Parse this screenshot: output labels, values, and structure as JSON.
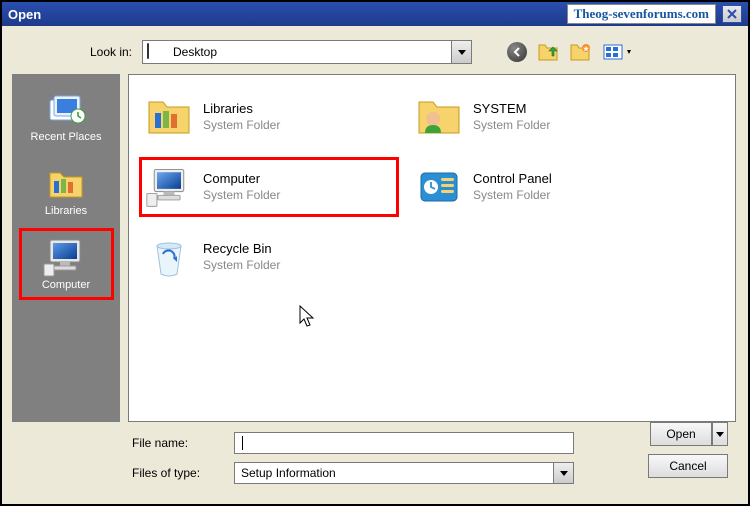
{
  "window": {
    "title": "Open",
    "watermark": "Theog-sevenforums.com"
  },
  "lookin": {
    "label": "Look in:",
    "value": "Desktop"
  },
  "places": [
    {
      "id": "recent-places",
      "label": "Recent Places"
    },
    {
      "id": "libraries",
      "label": "Libraries"
    },
    {
      "id": "computer",
      "label": "Computer",
      "selected": true
    }
  ],
  "items": [
    {
      "id": "libraries",
      "name": "Libraries",
      "sub": "System Folder"
    },
    {
      "id": "system",
      "name": "SYSTEM",
      "sub": "System Folder"
    },
    {
      "id": "computer",
      "name": "Computer",
      "sub": "System Folder",
      "highlighted": true
    },
    {
      "id": "control-panel",
      "name": "Control Panel",
      "sub": "System Folder"
    },
    {
      "id": "recycle-bin",
      "name": "Recycle Bin",
      "sub": "System Folder"
    }
  ],
  "filename": {
    "label": "File name:",
    "value": ""
  },
  "filetype": {
    "label": "Files of type:",
    "value": "Setup Information"
  },
  "buttons": {
    "open": "Open",
    "cancel": "Cancel"
  }
}
